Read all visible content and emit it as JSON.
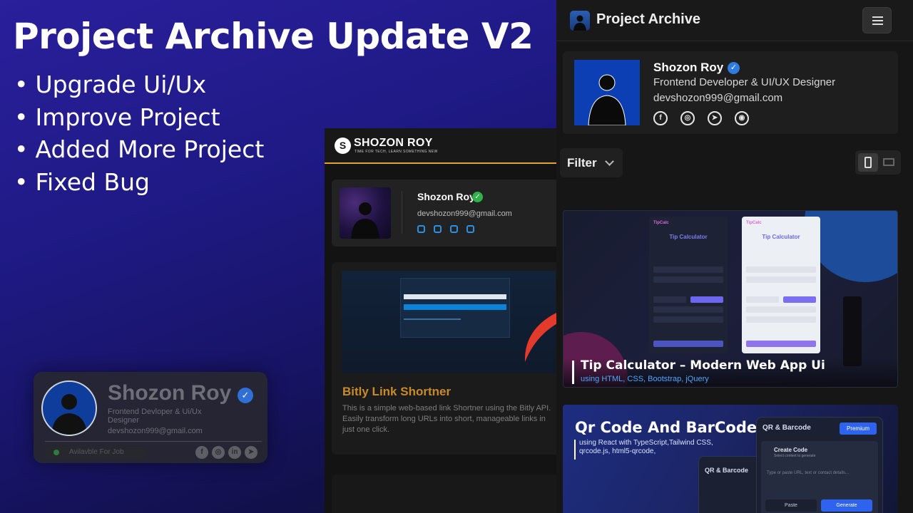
{
  "headline": "Project Archive Update V2",
  "bullets": [
    "Upgrade Ui/Ux",
    "Improve Project",
    "Added More Project",
    "Fixed Bug"
  ],
  "badge": {
    "name": "Shozon Roy",
    "role": "Frontend Devloper & Ui/Ux Designer",
    "email": "devshozon999@gmail.com",
    "status": "Avilavble For Job",
    "social_icons": [
      "facebook-icon",
      "instagram-icon",
      "linkedin-icon",
      "telegram-icon"
    ]
  },
  "mid": {
    "logo": "SHOZON ROY",
    "tagline": "TIME FOR TECH, LEARN SOMETHING NEW",
    "name": "Shozon Roy",
    "email": "devshozon999@gmail.com",
    "project_title": "Bitly Link Shortner",
    "project_desc": "This is a simple web-based link Shortner using the Bitly API. Easily transform long URLs into short, manageable links in just one click."
  },
  "right": {
    "app_title": "Project Archive",
    "profile": {
      "name": "Shozon Roy",
      "role": "Frontend Developer & UI/UX Designer",
      "email": "devshozon999@gmail.com",
      "social_icons": [
        "facebook-icon",
        "instagram-icon",
        "telegram-icon",
        "github-icon"
      ]
    },
    "filter_label": "Filter",
    "projects": [
      {
        "title": "Tip Calculator – Modern Web App Ui",
        "tech": "using HTML, CSS, Bootstrap, jQuery",
        "preview": {
          "app_name": "TipCalc",
          "heading": "Tip Calculator"
        }
      },
      {
        "title": "Qr Code And BarCode",
        "tech": "using React with TypeScript,Tailwind CSS, qrcode.js, html5-qrcode,",
        "preview": {
          "panel_title": "QR & Barcode",
          "premium": "Premium",
          "create": "Create Code",
          "create_sub": "Select content to generate",
          "placeholder": "Type or paste URL, text or contact details...",
          "paste": "Paste",
          "generate": "Generate"
        }
      }
    ]
  },
  "colors": {
    "accent_orange": "#e3a32d",
    "verify_green": "#2fb24a",
    "verify_blue": "#2f7bdf",
    "tech_blue": "#4ea6ff",
    "arrow_red": "#e43a2b"
  }
}
